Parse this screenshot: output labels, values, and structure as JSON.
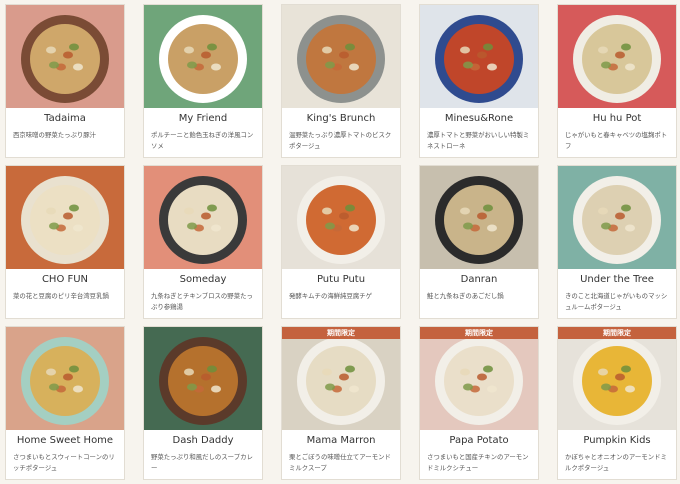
{
  "items": [
    {
      "title": "Tadaima",
      "desc": "西京味噌の野菜たっぷり豚汁",
      "bg": "#d99b8c",
      "bowl": "#7a4b35",
      "soup": "#cfa76a"
    },
    {
      "title": "My Friend",
      "desc": "ポルチーニと飴色玉ねぎの洋風コンソメ",
      "bg": "#6fa57a",
      "bowl": "#ffffff",
      "soup": "#c9a066"
    },
    {
      "title": "King's Brunch",
      "desc": "温野菜たっぷり濃厚トマトのビスクポタージュ",
      "bg": "#e8e3d8",
      "bowl": "#8d918e",
      "soup": "#c0773f"
    },
    {
      "title": "Minesu&Rone",
      "desc": "濃厚トマトと野菜がおいしい特製ミネストローネ",
      "bg": "#dfe4ea",
      "bowl": "#2f4b8f",
      "soup": "#c0462a"
    },
    {
      "title": "Hu hu Pot",
      "desc": "じゃがいもと春キャベツの塩麹ポトフ",
      "bg": "#d65a5a",
      "bowl": "#f0ede4",
      "soup": "#d8c79a"
    },
    {
      "title": "CHO FUN",
      "desc": "菜の花と豆腐のピリ辛台湾豆乳鍋",
      "bg": "#c86a3b",
      "bowl": "#e9e1cf",
      "soup": "#ece0c4"
    },
    {
      "title": "Someday",
      "desc": "九条ねぎとチキンブロスの野菜たっぷり参鶏湯",
      "bg": "#e28f79",
      "bowl": "#3a3a3a",
      "soup": "#e8dcc2"
    },
    {
      "title": "Putu Putu",
      "desc": "発酵キムチの海鮮純豆腐チゲ",
      "bg": "#e6e1d8",
      "bowl": "#f2efe8",
      "soup": "#d06a33"
    },
    {
      "title": "Danran",
      "desc": "鮭と九条ねぎのあごだし鍋",
      "bg": "#c7bfae",
      "bowl": "#2b2b2b",
      "soup": "#c9b48a"
    },
    {
      "title": "Under the Tree",
      "desc": "きのこと北海道じゃがいものマッシュルームポタージュ",
      "bg": "#7fb1a5",
      "bowl": "#f2efe8",
      "soup": "#ddd0b2"
    },
    {
      "title": "Home Sweet Home",
      "desc": "さつまいもとスウィートコーンのリッチポタージュ",
      "bg": "#d9a38a",
      "bowl": "#a4cfc2",
      "soup": "#d7b15c"
    },
    {
      "title": "Dash Daddy",
      "desc": "野菜たっぷり和風だしのスープカレー",
      "bg": "#456a52",
      "bowl": "#5b3a2a",
      "soup": "#b5712d"
    },
    {
      "title": "Mama Marron",
      "desc": "栗とごぼうの味噌仕立てアーモンドミルクスープ",
      "bg": "#d9d2c3",
      "bowl": "#f2efe8",
      "soup": "#e6dcc4",
      "badge": "期間限定"
    },
    {
      "title": "Papa Potato",
      "desc": "さつまいもと国産チキンのアーモンドミルクシチュー",
      "bg": "#e4c8be",
      "bowl": "#f2efe8",
      "soup": "#eadfca",
      "badge": "期間限定"
    },
    {
      "title": "Pumpkin Kids",
      "desc": "かぼちゃとオニオンのアーモンドミルクポタージュ",
      "bg": "#e6e2da",
      "bowl": "#f2efe8",
      "soup": "#e8b637",
      "badge": "期間限定"
    }
  ]
}
